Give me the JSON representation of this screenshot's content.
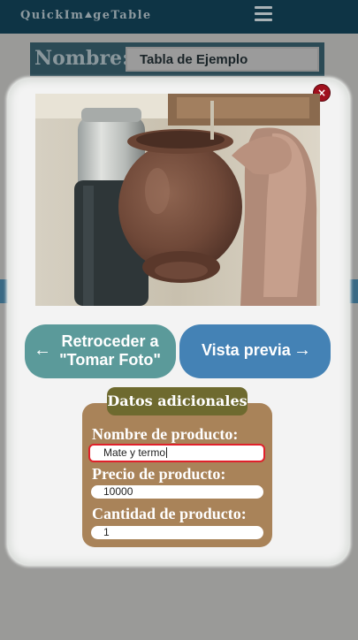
{
  "app": {
    "brand": {
      "before": "QuickIm",
      "after": "geTable"
    },
    "menu_icon": "hamburger-icon"
  },
  "background": {
    "name_label": "Nombre:",
    "name_value": "Tabla de Ejemplo"
  },
  "modal": {
    "close_label": "×",
    "close_icon": "close-icon",
    "photo": {
      "subject": "mate-gourd-and-thermos-photo"
    },
    "buttons": {
      "back": {
        "arrow": "←",
        "label": "Retroceder a \"Tomar Foto\"",
        "icon": "arrow-left-icon"
      },
      "preview": {
        "label": "Vista previa",
        "arrow": "→",
        "icon": "arrow-right-icon"
      }
    },
    "extra": {
      "title": "Datos adicionales",
      "fields": [
        {
          "label": "Nombre de producto:",
          "value": "Mate y termo"
        },
        {
          "label": "Precio de producto:",
          "value": "10000"
        },
        {
          "label": "Cantidad de producto:",
          "value": "1"
        }
      ]
    }
  },
  "colors": {
    "topbar": "#0e3445",
    "close": "#a0101d",
    "back_button": "#5b9a9a",
    "preview_button": "#4482b5",
    "extra_panel": "#a98359",
    "extra_title": "#6e6a2f",
    "active_border": "#e0202a"
  }
}
